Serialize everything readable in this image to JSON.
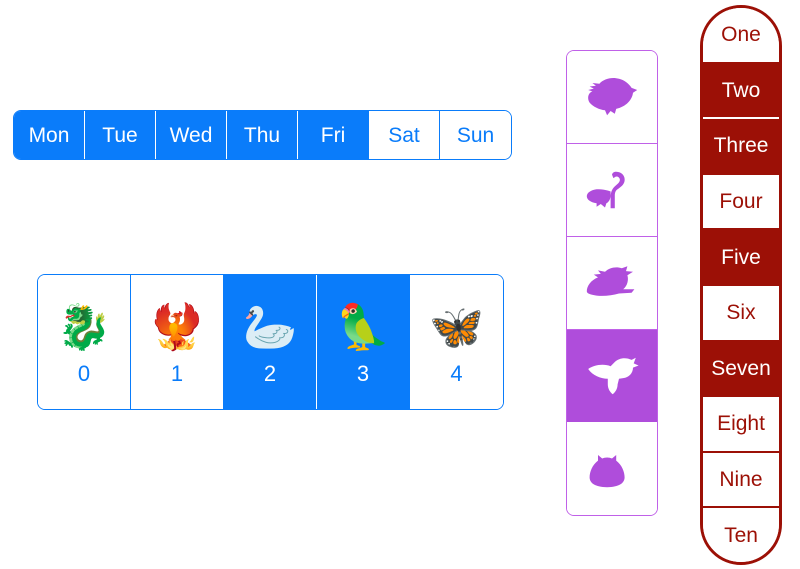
{
  "colors": {
    "blue": "#0a7cfa",
    "purple": "#af4ddb",
    "purple_border": "#c061e8",
    "red": "#9c1006",
    "white": "#ffffff"
  },
  "weekday_segmented": {
    "name": "weekday-segmented-control",
    "items": [
      {
        "label": "Mon",
        "selected": true
      },
      {
        "label": "Tue",
        "selected": true
      },
      {
        "label": "Wed",
        "selected": true
      },
      {
        "label": "Thu",
        "selected": true
      },
      {
        "label": "Fri",
        "selected": true
      },
      {
        "label": "Sat",
        "selected": false
      },
      {
        "label": "Sun",
        "selected": false
      }
    ]
  },
  "emoji_row": {
    "name": "emoji-index-row",
    "items": [
      {
        "label": "0",
        "icon": "dragon-emoji",
        "glyph": "🐉",
        "selected": false
      },
      {
        "label": "1",
        "icon": "phoenix-emoji",
        "glyph": "🐦‍🔥",
        "selected": false
      },
      {
        "label": "2",
        "icon": "swan-emoji",
        "glyph": "🦢",
        "selected": true
      },
      {
        "label": "3",
        "icon": "parrot-emoji",
        "glyph": "🦜",
        "selected": true
      },
      {
        "label": "4",
        "icon": "butterfly-emoji",
        "glyph": "🦋",
        "selected": false
      }
    ]
  },
  "bird_column": {
    "name": "bird-silhouette-column",
    "items": [
      {
        "icon": "dove-icon",
        "selected": false
      },
      {
        "icon": "flamingo-icon",
        "selected": false
      },
      {
        "icon": "flying-duck-icon",
        "selected": false
      },
      {
        "icon": "hummingbird-icon",
        "selected": true
      },
      {
        "icon": "owl-icon",
        "selected": false
      }
    ]
  },
  "number_list": {
    "name": "number-pill-list",
    "items": [
      {
        "label": "One",
        "selected": false
      },
      {
        "label": "Two",
        "selected": true
      },
      {
        "label": "Three",
        "selected": true
      },
      {
        "label": "Four",
        "selected": false
      },
      {
        "label": "Five",
        "selected": true
      },
      {
        "label": "Six",
        "selected": false
      },
      {
        "label": "Seven",
        "selected": true
      },
      {
        "label": "Eight",
        "selected": false
      },
      {
        "label": "Nine",
        "selected": false
      },
      {
        "label": "Ten",
        "selected": false
      }
    ]
  }
}
